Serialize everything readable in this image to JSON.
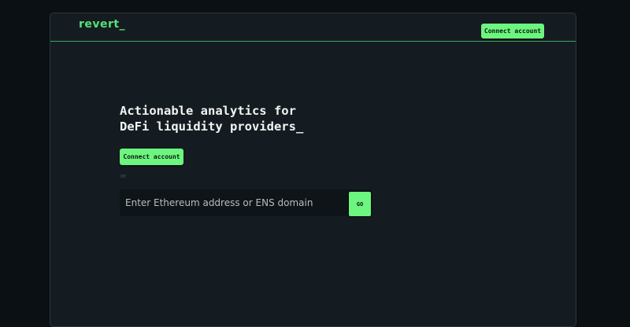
{
  "header": {
    "logo_text": "revert_",
    "connect_label": "Connect account"
  },
  "hero": {
    "headline_line1": "Actionable analytics for",
    "headline_line2": "DeFi liquidity providers_",
    "connect_label": "Connect account",
    "or_text": "or"
  },
  "search": {
    "value": "",
    "placeholder": "Enter Ethereum address or ENS domain",
    "go_label": "GO"
  },
  "colors": {
    "accent": "#6cf57f",
    "logo": "#56e07a",
    "background": "#151c21",
    "page_background": "#0b1014"
  }
}
